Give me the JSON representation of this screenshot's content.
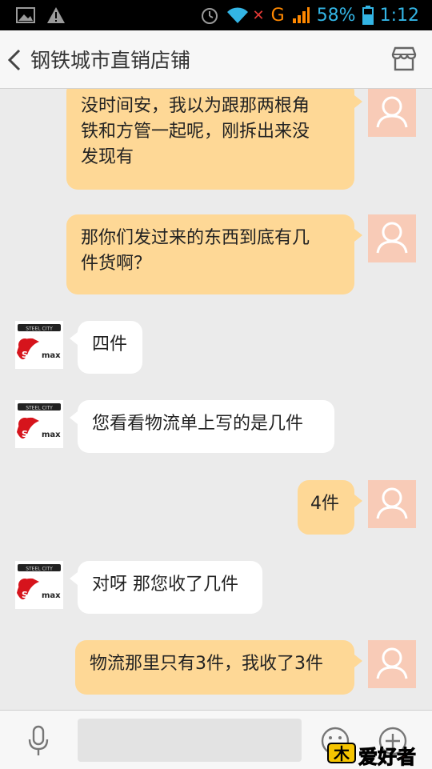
{
  "status_bar": {
    "network_letter": "G",
    "battery": "58%",
    "time": "1:12"
  },
  "header": {
    "title": "钢铁城市直销店铺",
    "back_icon": "chevron-left-icon",
    "store_icon": "store-icon"
  },
  "messages": [
    {
      "side": "right",
      "lines": [
        "没时间安，我以为跟那两根角",
        "铁和方管一起呢，刚拆出来没",
        "发现有"
      ]
    },
    {
      "side": "right",
      "lines": [
        "那你们发过来的东西到底有几",
        "件货啊？"
      ]
    },
    {
      "side": "left",
      "lines": [
        "四件"
      ]
    },
    {
      "side": "left",
      "lines": [
        "您看看物流单上写的是几件"
      ]
    },
    {
      "side": "right",
      "lines": [
        "4件"
      ]
    },
    {
      "side": "left",
      "lines": [
        "对呀 那您收了几件"
      ]
    },
    {
      "side": "right",
      "lines": [
        "物流那里只有3件，我收了3件"
      ]
    }
  ],
  "shop_avatar": {
    "top_text": "STEEL CITY",
    "brand": "Shinmax",
    "brand_color": "#d6141c"
  },
  "bottom_bar": {
    "mic_icon": "microphone-icon",
    "input_value": "",
    "emoji_icon": "emoji-icon",
    "plus_icon": "plus-icon"
  },
  "watermark": {
    "text": "爱好者"
  },
  "colors": {
    "right_bubble": "#fed896",
    "left_bubble": "#ffffff",
    "user_avatar": "#f8cbb7",
    "accent": "#33b5e5"
  }
}
